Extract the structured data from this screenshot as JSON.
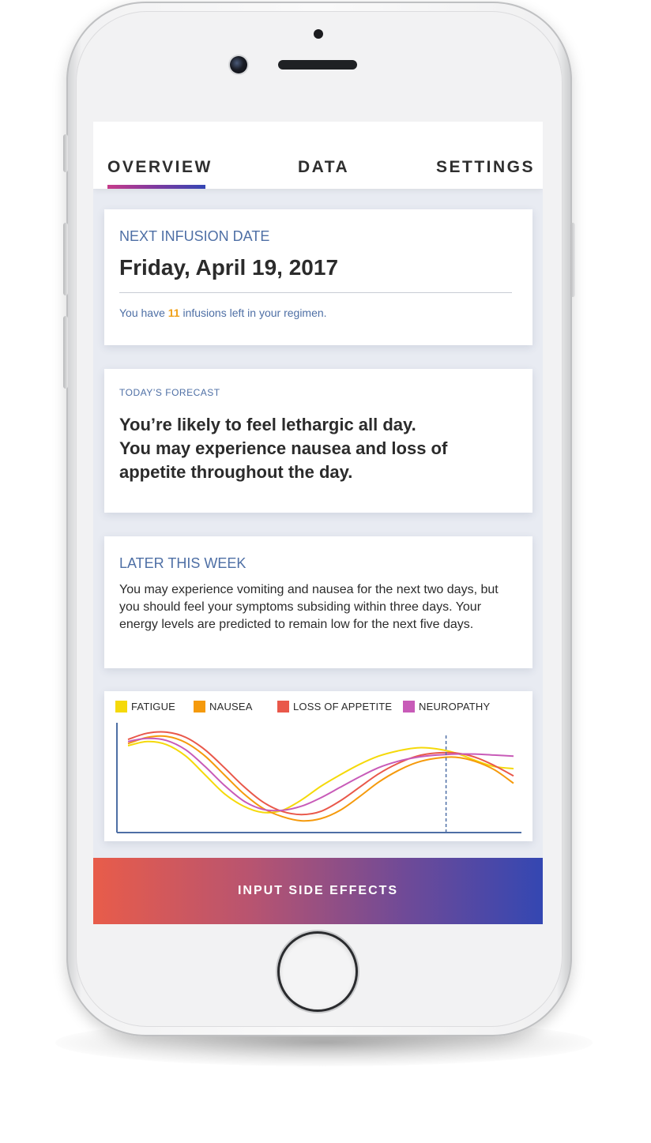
{
  "tabs": [
    {
      "label": "OVERVIEW",
      "active": true
    },
    {
      "label": "DATA",
      "active": false
    },
    {
      "label": "SETTINGS",
      "active": false
    }
  ],
  "next_infusion": {
    "label": "NEXT INFUSION DATE",
    "date": "Friday, April 19, 2017",
    "remaining_prefix": "You have ",
    "remaining_count": "11",
    "remaining_suffix": " infusions left in your regimen."
  },
  "forecast": {
    "label": "TODAY’S FORECAST",
    "line1": "You’re likely to feel lethargic all day.",
    "line2": "You may experience nausea and loss of appetite throughout the day."
  },
  "later": {
    "label": "LATER THIS WEEK",
    "text": "You may experience vomiting and nausea for the next two days, but you should feel your symptoms subsiding within three days. Your energy levels are predicted to remain low for the next five days."
  },
  "legend": [
    {
      "label": "FATIGUE",
      "color": "#f5d90a"
    },
    {
      "label": "NAUSEA",
      "color": "#f59a0c"
    },
    {
      "label": "LOSS OF APPETITE",
      "color": "#e9584a"
    },
    {
      "label": "NEUROPATHY",
      "color": "#c85bb8"
    }
  ],
  "chart_data": {
    "type": "line",
    "x": [
      0,
      1,
      2,
      3,
      4,
      5,
      6,
      7,
      8,
      9,
      10,
      11,
      12,
      13,
      14,
      15,
      16,
      17,
      18,
      19,
      20
    ],
    "series": [
      {
        "name": "FATIGUE",
        "color": "#f5d90a",
        "values": [
          0.78,
          0.82,
          0.79,
          0.68,
          0.5,
          0.32,
          0.2,
          0.14,
          0.16,
          0.26,
          0.39,
          0.5,
          0.6,
          0.68,
          0.73,
          0.76,
          0.75,
          0.71,
          0.64,
          0.58,
          0.56
        ]
      },
      {
        "name": "NAUSEA",
        "color": "#f59a0c",
        "values": [
          0.8,
          0.86,
          0.87,
          0.81,
          0.68,
          0.5,
          0.32,
          0.18,
          0.1,
          0.06,
          0.08,
          0.16,
          0.29,
          0.43,
          0.54,
          0.62,
          0.66,
          0.67,
          0.63,
          0.55,
          0.42
        ]
      },
      {
        "name": "LOSS OF APPETITE",
        "color": "#e9584a",
        "values": [
          0.84,
          0.9,
          0.91,
          0.86,
          0.74,
          0.57,
          0.39,
          0.24,
          0.15,
          0.12,
          0.15,
          0.25,
          0.38,
          0.51,
          0.61,
          0.68,
          0.71,
          0.71,
          0.67,
          0.59,
          0.49
        ]
      },
      {
        "name": "NEUROPATHY",
        "color": "#c85bb8",
        "values": [
          0.82,
          0.85,
          0.83,
          0.74,
          0.58,
          0.4,
          0.25,
          0.17,
          0.16,
          0.2,
          0.28,
          0.38,
          0.48,
          0.57,
          0.63,
          0.67,
          0.69,
          0.7,
          0.7,
          0.69,
          0.68
        ]
      }
    ],
    "marker_x": 16.5,
    "xlim": [
      0,
      20
    ],
    "ylim": [
      0,
      1
    ]
  },
  "cta": {
    "label": "INPUT SIDE EFFECTS"
  }
}
